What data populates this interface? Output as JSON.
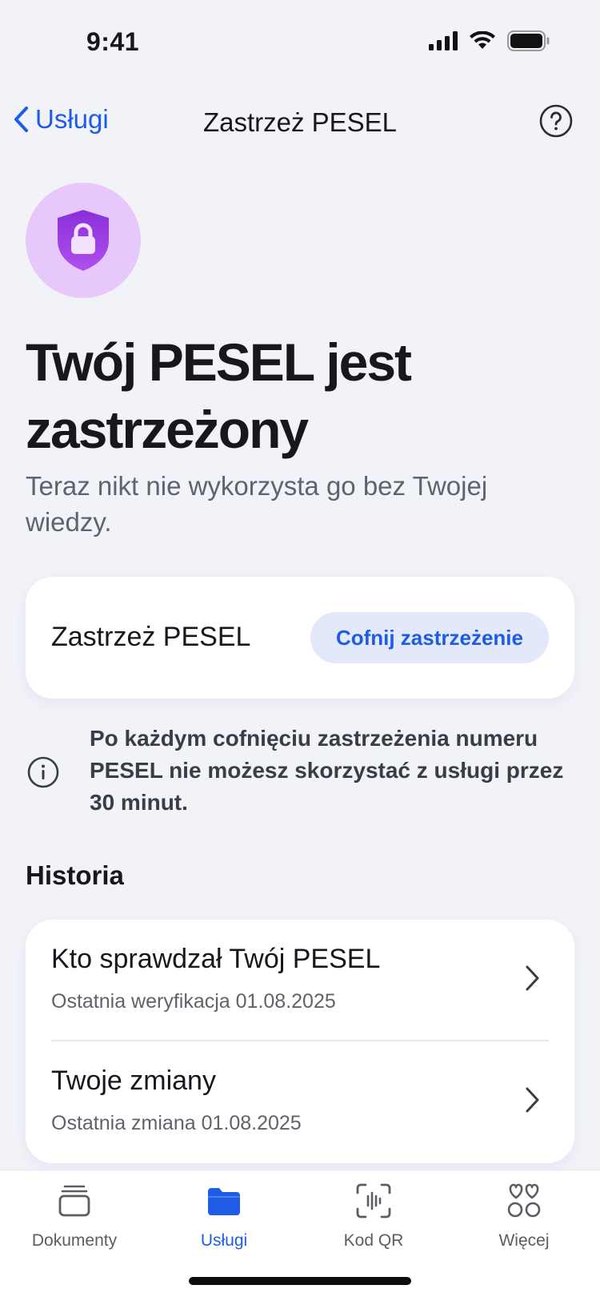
{
  "status_bar": {
    "time": "9:41"
  },
  "nav": {
    "back_label": "Usługi",
    "title": "Zastrzeż PESEL"
  },
  "hero": {
    "title": "Twój PESEL jest zastrzeżony",
    "subtitle": "Teraz nikt nie wykorzysta go bez Twojej wiedzy."
  },
  "toggle_card": {
    "label": "Zastrzeż PESEL",
    "button": "Cofnij zastrzeżenie"
  },
  "info": {
    "text": "Po każdym cofnięciu zastrzeżenia numeru PESEL nie możesz skorzystać z usługi przez 30 minut."
  },
  "history": {
    "title": "Historia",
    "items": [
      {
        "title": "Kto sprawdzał Twój PESEL",
        "subtitle": "Ostatnia weryfikacja 01.08.2025"
      },
      {
        "title": "Twoje zmiany",
        "subtitle": "Ostatnia zmiana 01.08.2025"
      }
    ]
  },
  "tab_bar": {
    "tabs": [
      {
        "label": "Dokumenty",
        "icon": "cards-stack-icon",
        "active": false
      },
      {
        "label": "Usługi",
        "icon": "folder-icon",
        "active": true
      },
      {
        "label": "Kod QR",
        "icon": "qr-scan-icon",
        "active": false
      },
      {
        "label": "Więcej",
        "icon": "more-grid-icon",
        "active": false
      }
    ]
  },
  "colors": {
    "accent": "#1f5ce5",
    "background": "#f2f3f9",
    "hero_circle": "#e7c8fb",
    "shield": "#9b3fe0"
  }
}
